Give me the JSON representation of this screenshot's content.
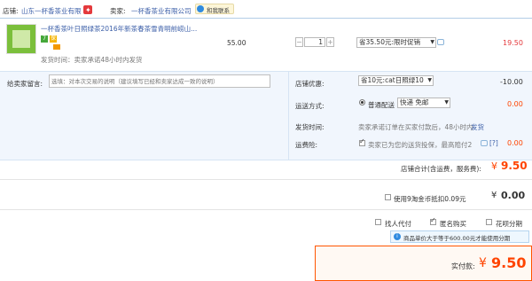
{
  "header": {
    "shop_label": "店铺:",
    "shop_name": "山东一杯香茶业有限",
    "seller_label": "卖家:",
    "seller_name": "一杯香茶业有限公司",
    "contact_label": "和我联系"
  },
  "item": {
    "title": "一杯香茶叶日照绿茶2016年新茶春茶雪青明前崂山...",
    "price": "55.00",
    "quantity": "1",
    "promotion": "省35.50元:限时促销",
    "subtotal": "19.50",
    "shipping_time": "发货时间：卖家承诺48小时内发货",
    "badges": [
      "7",
      "保"
    ]
  },
  "message": {
    "label": "给卖家留言:",
    "placeholder": "选填：对本次交易的说明（建议填写已经和卖家达成一致的说明）"
  },
  "shop_discount": {
    "label": "店铺优惠:",
    "value": "省10元:cat日照绿10",
    "amount": "-10.00"
  },
  "delivery": {
    "label": "运送方式:",
    "option": "普通配送",
    "select": "快递 免邮",
    "amount": "0.00"
  },
  "ship_time": {
    "label": "发货时间:",
    "text": "卖家承诺订单在买家付款后，48小时内",
    "link": "发货"
  },
  "insurance": {
    "label": "运费险:",
    "text": "卖家已为您的送货投保，最高赔付2",
    "help": "[?]",
    "amount": "0.00"
  },
  "store_total": {
    "label": "店铺合计(含运费，服务费):",
    "currency": "¥",
    "amount": "9.50"
  },
  "coins": {
    "label": "使用9淘金币抵扣0.09元",
    "currency": "¥",
    "amount": "0.00"
  },
  "options": {
    "agent_pay": "找人代付",
    "anonymous": "匿名购买",
    "installment": "花呗分期"
  },
  "notice": {
    "text": "商品单价大于等于600.00元才能使用分期"
  },
  "payment": {
    "label": "实付款:",
    "currency": "¥",
    "amount": "9.50"
  },
  "colors": {
    "price_red": "#e4393c",
    "orange": "#ff4400",
    "link_blue": "#3c5fa8",
    "row_bg": "#f1f6fd",
    "notice_bg": "#eef7fe",
    "pay_border": "#ff5500"
  }
}
